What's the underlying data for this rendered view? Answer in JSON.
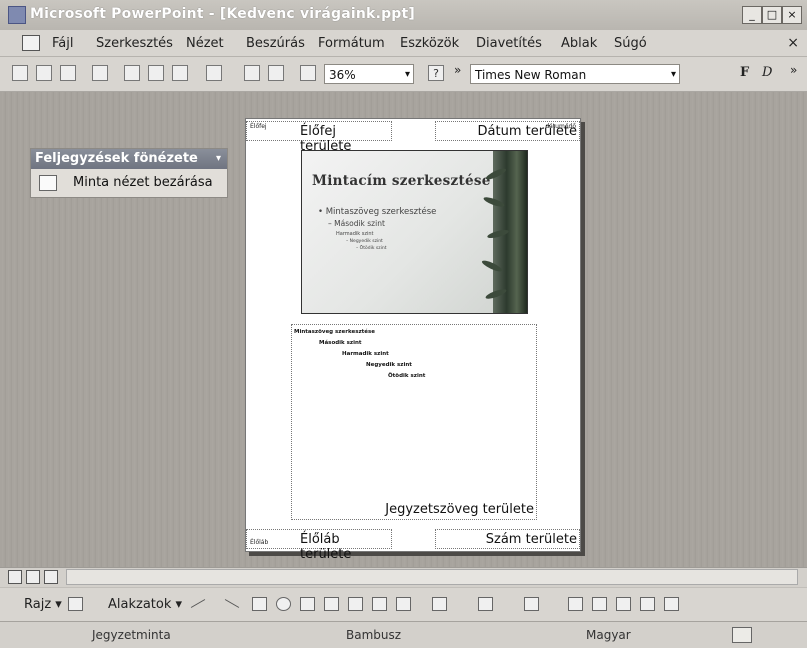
{
  "window": {
    "title": "Microsoft PowerPoint - [Kedvenc virágaink.ppt]",
    "controls": [
      "_",
      "□",
      "×"
    ]
  },
  "menubar": {
    "items": [
      "Fájl",
      "Szerkesztés",
      "Nézet",
      "Beszúrás",
      "Formátum",
      "Eszközök",
      "Diavetítés",
      "Ablak",
      "Súgó"
    ],
    "close_label": "×"
  },
  "toolbar": {
    "zoom": "36%",
    "font": "Times New Roman",
    "bold_label": "F",
    "italic_label": "D",
    "help_label": "?"
  },
  "notes_master_toolbar": {
    "title": "Feljegyzések fönézete",
    "close_action": "Minta nézet bezárása"
  },
  "notes_page": {
    "header_corner": "Élőfej",
    "header_label": "Élőfej területe",
    "date_corner": "dátum/idő",
    "date_label": "Dátum területe",
    "slide": {
      "title": "Mintacím szerkesztése",
      "bullets": [
        "• Mintaszöveg szerkesztése",
        "– Második szint",
        "Harmadik szint",
        "– Negyedik szint",
        "– Ötödik szint"
      ]
    },
    "notes_lines": [
      "Mintaszöveg szerkesztése",
      "Második szint",
      "Harmadik szint",
      "Negyedik szint",
      "Ötödik szint"
    ],
    "notes_label": "Jegyzetszöveg területe",
    "footer_corner": "Élőláb",
    "footer_label": "Élőláb területe",
    "number_label": "Szám területe"
  },
  "drawing_toolbar": {
    "draw_label": "Rajz ▾",
    "autoshapes_label": "Alakzatok ▾"
  },
  "statusbar": {
    "view": "Jegyzetminta",
    "design": "Bambusz",
    "language": "Magyar"
  }
}
